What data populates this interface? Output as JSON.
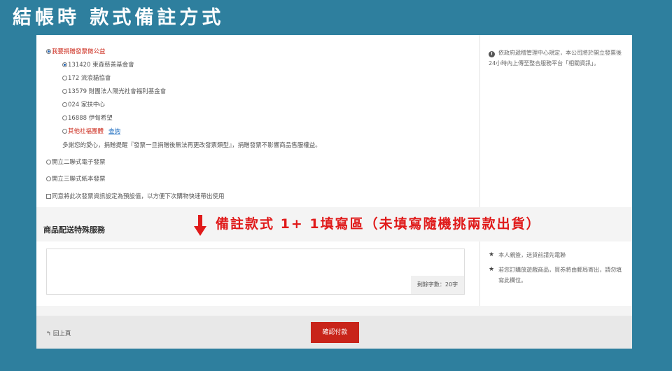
{
  "slide_title": "結帳時  款式備註方式",
  "invoice": {
    "donate_label": "我要捐贈發票做公益",
    "charities": [
      "131420 東森慈善基金會",
      "172 流浪貓協會",
      "13579 財團法人陽光社會福利基金會",
      "024 家扶中心",
      "16888 伊甸希望"
    ],
    "other_label": "其他社福團體",
    "query_link": "查詢",
    "thanks_note": "多謝您的愛心，捐贈提醒『發票一旦捐贈後無法再更改發票類型』，捐贈發票不影響商品售服權益。",
    "duplicate_label": "開立二聯式電子發票",
    "triplicate_label": "開立三聯式紙本發票",
    "save_default_label": "同意將此次發票資訊設定為預設值，以方便下次購物快速帶出使用"
  },
  "side_note": {
    "icon": "info-icon",
    "text": "依政府遞稽管理中心規定，本公司將於開立發票後24小時內上傳至整合服務平台「相關資訊」。"
  },
  "service": {
    "title": "商品配送特殊服務",
    "annotation": "備註款式 1+ 1填寫區（未填寫隨機挑兩款出貨）",
    "counter": "剩餘字數：20字",
    "notes": [
      "本人親簽，送貨前請先電聯",
      "若您訂購放遊戲商品，買券將由郵局寄出，請勿填寫此欄位。"
    ]
  },
  "footer": {
    "back_label": "回上頁",
    "confirm_label": "確認付款"
  },
  "colors": {
    "background": "#2e7f9e",
    "confirm_button": "#c8241a",
    "annotation": "#e01a1a",
    "donate_text": "#cc2b1d",
    "link": "#1f6fc2"
  }
}
